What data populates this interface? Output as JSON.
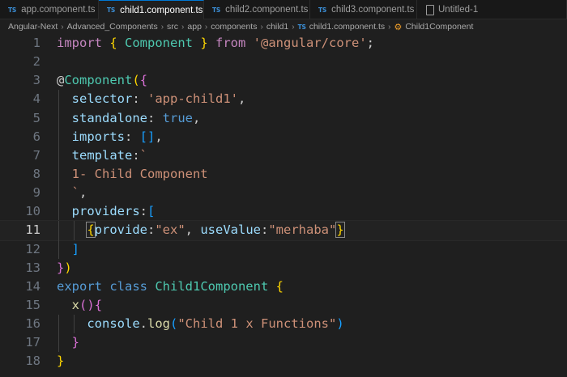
{
  "tabs": [
    {
      "icon": "TS",
      "label": "app.component.ts",
      "active": false
    },
    {
      "icon": "TS",
      "label": "child1.component.ts",
      "active": true,
      "close": "×"
    },
    {
      "icon": "TS",
      "label": "child2.component.ts",
      "active": false
    },
    {
      "icon": "TS",
      "label": "child3.component.ts",
      "active": false
    },
    {
      "icon": "file-icon",
      "label": "Untitled-1",
      "active": false
    }
  ],
  "breadcrumb": {
    "items": [
      "Angular-Next",
      "Advanced_Components",
      "src",
      "app",
      "components",
      "child1"
    ],
    "file_icon": "TS",
    "file": "child1.component.ts",
    "symbol": "Child1Component",
    "separator": "›"
  },
  "editor": {
    "line_numbers": [
      "1",
      "2",
      "3",
      "4",
      "5",
      "6",
      "7",
      "8",
      "9",
      "10",
      "11",
      "12",
      "13",
      "14",
      "15",
      "16",
      "17",
      "18"
    ],
    "current_line": 11,
    "lines": [
      [
        [
          "kw",
          "import "
        ],
        [
          "b1",
          "{ "
        ],
        [
          "cls",
          "Component"
        ],
        [
          "b1",
          " }"
        ],
        [
          "kw",
          " from "
        ],
        [
          "str",
          "'@angular/core'"
        ],
        [
          "def",
          ";"
        ]
      ],
      [],
      [
        [
          "def",
          "@"
        ],
        [
          "cls",
          "Component"
        ],
        [
          "b1",
          "("
        ],
        [
          "b2",
          "{"
        ]
      ],
      [
        [
          "def",
          "  "
        ],
        [
          "prop",
          "selector"
        ],
        [
          "def",
          ": "
        ],
        [
          "str",
          "'app-child1'"
        ],
        [
          "def",
          ","
        ]
      ],
      [
        [
          "def",
          "  "
        ],
        [
          "prop",
          "standalone"
        ],
        [
          "def",
          ": "
        ],
        [
          "kb",
          "true"
        ],
        [
          "def",
          ","
        ]
      ],
      [
        [
          "def",
          "  "
        ],
        [
          "prop",
          "imports"
        ],
        [
          "def",
          ": "
        ],
        [
          "b3",
          "[]"
        ],
        [
          "def",
          ","
        ]
      ],
      [
        [
          "def",
          "  "
        ],
        [
          "prop",
          "template"
        ],
        [
          "def",
          ":"
        ],
        [
          "str",
          "`"
        ]
      ],
      [
        [
          "str",
          "  1- Child Component"
        ]
      ],
      [
        [
          "str",
          "  `"
        ],
        [
          "def",
          ","
        ]
      ],
      [
        [
          "def",
          "  "
        ],
        [
          "prop",
          "providers"
        ],
        [
          "def",
          ":"
        ],
        [
          "b3",
          "["
        ]
      ],
      [
        [
          "def",
          "    "
        ],
        [
          "b1",
          "{"
        ],
        [
          "prop",
          "provide"
        ],
        [
          "def",
          ":"
        ],
        [
          "str",
          "\"ex\""
        ],
        [
          "def",
          ", "
        ],
        [
          "prop",
          "useValue"
        ],
        [
          "def",
          ":"
        ],
        [
          "str",
          "\"merhaba\""
        ],
        [
          "b1",
          "}"
        ]
      ],
      [
        [
          "def",
          "  "
        ],
        [
          "b3",
          "]"
        ]
      ],
      [
        [
          "b2",
          "}"
        ],
        [
          "b1",
          ")"
        ]
      ],
      [
        [
          "kb",
          "export "
        ],
        [
          "kb",
          "class "
        ],
        [
          "cls",
          "Child1Component"
        ],
        [
          "def",
          " "
        ],
        [
          "b1",
          "{"
        ]
      ],
      [
        [
          "def",
          "  "
        ],
        [
          "fn",
          "x"
        ],
        [
          "b2",
          "()"
        ],
        [
          "b2",
          "{"
        ]
      ],
      [
        [
          "def",
          "    "
        ],
        [
          "prop",
          "console"
        ],
        [
          "def",
          "."
        ],
        [
          "fn",
          "log"
        ],
        [
          "b3",
          "("
        ],
        [
          "str",
          "\"Child 1 x Functions\""
        ],
        [
          "b3",
          ")"
        ]
      ],
      [
        [
          "def",
          "  "
        ],
        [
          "b2",
          "}"
        ]
      ],
      [
        [
          "b1",
          "}"
        ]
      ]
    ]
  }
}
